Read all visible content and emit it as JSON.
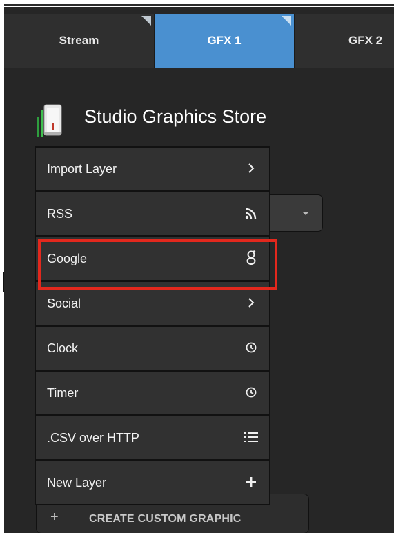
{
  "tabs": [
    {
      "label": "Stream",
      "active": false
    },
    {
      "label": "GFX 1",
      "active": true
    },
    {
      "label": "GFX 2",
      "active": false
    }
  ],
  "store": {
    "title": "Studio Graphics Store",
    "icon": "store-app-icon"
  },
  "menu": {
    "items": [
      {
        "label": "Import Layer",
        "icon": "chevron-right-icon"
      },
      {
        "label": "RSS",
        "icon": "rss-icon"
      },
      {
        "label": "Google",
        "icon": "google-icon",
        "highlighted": true
      },
      {
        "label": "Social",
        "icon": "chevron-right-icon"
      },
      {
        "label": "Clock",
        "icon": "clock-icon"
      },
      {
        "label": "Timer",
        "icon": "clock-icon"
      },
      {
        "label": ".CSV over HTTP",
        "icon": "list-icon"
      },
      {
        "label": "New Layer",
        "icon": "plus-icon"
      }
    ]
  },
  "create_button": {
    "label": "CREATE CUSTOM GRAPHIC",
    "icon": "plus-icon"
  },
  "colors": {
    "tab_active": "#4a90d0",
    "highlight": "#e3281d",
    "menu_bg": "#313131",
    "panel_bg": "#262626"
  }
}
